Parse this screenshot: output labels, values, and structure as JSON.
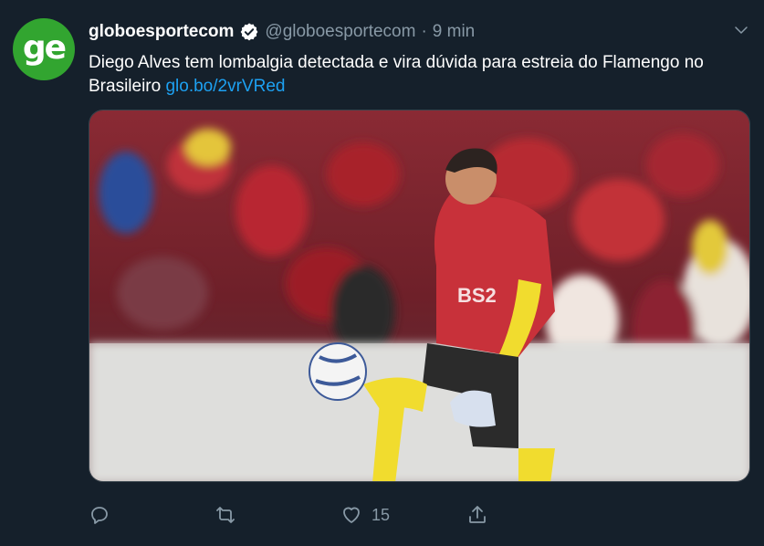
{
  "tweet": {
    "avatar_text": "ge",
    "display_name": "globoesportecom",
    "handle": "@globoesportecom",
    "separator": "·",
    "time": "9 min",
    "text": "Diego Alves tem lombalgia detectada e vira dúvida para estreia do Flamengo no Brasileiro",
    "link": "glo.bo/2vrVRed",
    "likes": "15"
  },
  "colors": {
    "background": "#15202b",
    "avatar": "#32a530",
    "link": "#1da1f2",
    "muted": "#8899a6"
  },
  "icons": {
    "verified": "verified-badge-icon",
    "menu": "chevron-down-icon",
    "reply": "reply-icon",
    "retweet": "retweet-icon",
    "like": "heart-icon",
    "share": "share-icon"
  }
}
